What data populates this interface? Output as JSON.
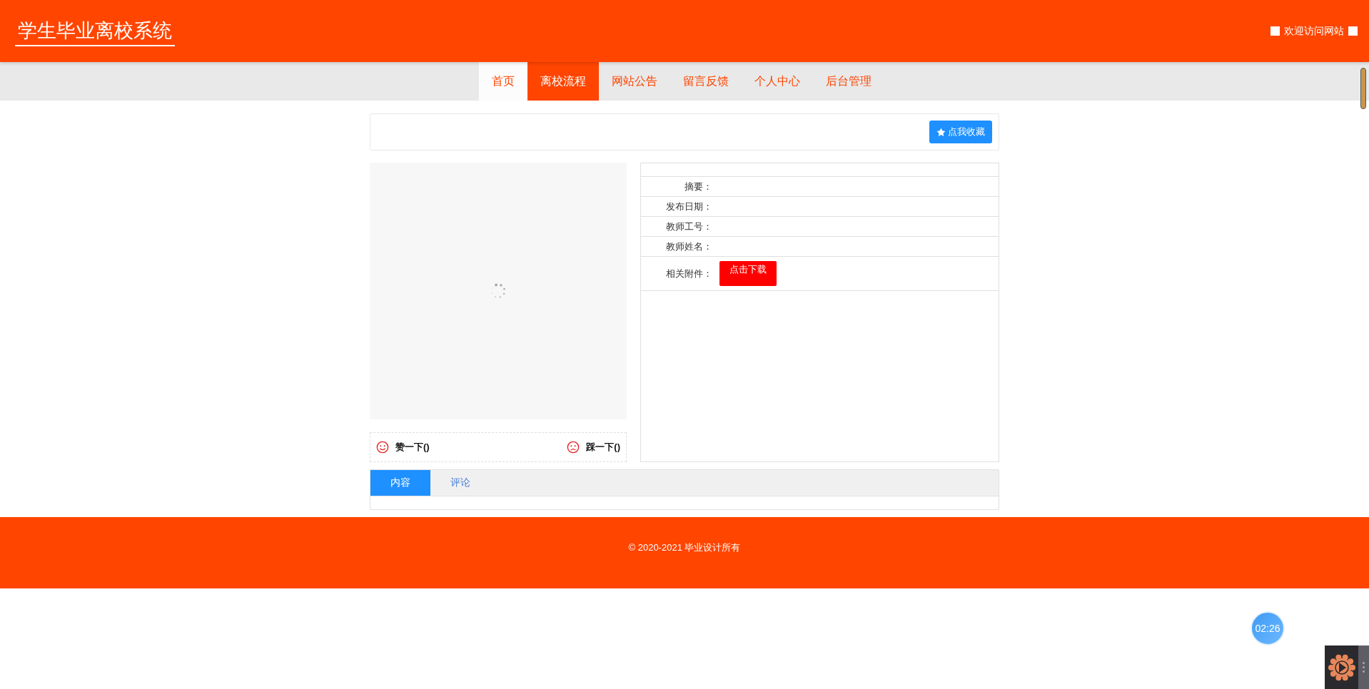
{
  "header": {
    "title": "学生毕业离校系统",
    "welcome": "欢迎访问网站"
  },
  "nav": [
    {
      "label": "首页",
      "selected": false,
      "hover": true
    },
    {
      "label": "离校流程",
      "selected": true,
      "hover": false
    },
    {
      "label": "网站公告",
      "selected": false,
      "hover": false
    },
    {
      "label": "留言反馈",
      "selected": false,
      "hover": false
    },
    {
      "label": "个人中心",
      "selected": false,
      "hover": false
    },
    {
      "label": "后台管理",
      "selected": false,
      "hover": false
    }
  ],
  "favorite_button": "点我收藏",
  "preview": {
    "loading": true
  },
  "details": [
    {
      "label": "摘要："
    },
    {
      "label": "发布日期："
    },
    {
      "label": "教师工号："
    },
    {
      "label": "教师姓名："
    },
    {
      "label": "相关附件：",
      "kind": "download",
      "button": "点击下载"
    }
  ],
  "votes": {
    "like": "赞一下()",
    "dislike": "踩一下()"
  },
  "tabs": [
    {
      "label": "内容",
      "selected": true
    },
    {
      "label": "评论",
      "selected": false
    }
  ],
  "footer": "© 2020-2021 毕业设计所有",
  "timer": "02:26"
}
